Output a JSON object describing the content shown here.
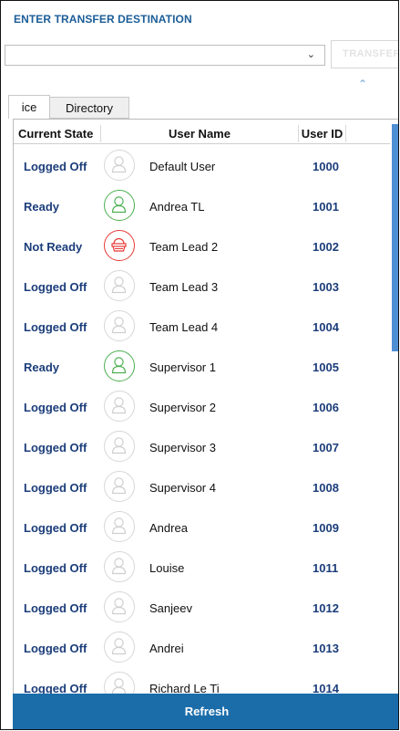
{
  "header": {
    "title": "ENTER TRANSFER DESTINATION",
    "transfer_label": "TRANSFER",
    "combo_value": ""
  },
  "tabs": [
    {
      "label": "ice",
      "active": true
    },
    {
      "label": "Directory",
      "active": false
    }
  ],
  "table": {
    "columns": [
      "Current State",
      "User Name",
      "User ID"
    ],
    "rows": [
      {
        "state": "Logged Off",
        "name": "Default User",
        "id": "1000",
        "status": "off"
      },
      {
        "state": "Ready",
        "name": "Andrea TL",
        "id": "1001",
        "status": "ready"
      },
      {
        "state": "Not Ready",
        "name": "Team Lead 2",
        "id": "1002",
        "status": "notready"
      },
      {
        "state": "Logged Off",
        "name": "Team Lead 3",
        "id": "1003",
        "status": "off"
      },
      {
        "state": "Logged Off",
        "name": "Team Lead 4",
        "id": "1004",
        "status": "off"
      },
      {
        "state": "Ready",
        "name": "Supervisor 1",
        "id": "1005",
        "status": "ready"
      },
      {
        "state": "Logged Off",
        "name": "Supervisor 2",
        "id": "1006",
        "status": "off"
      },
      {
        "state": "Logged Off",
        "name": "Supervisor 3",
        "id": "1007",
        "status": "off"
      },
      {
        "state": "Logged Off",
        "name": "Supervisor 4",
        "id": "1008",
        "status": "off"
      },
      {
        "state": "Logged Off",
        "name": "Andrea",
        "id": "1009",
        "status": "off"
      },
      {
        "state": "Logged Off",
        "name": "Louise",
        "id": "1011",
        "status": "off"
      },
      {
        "state": "Logged Off",
        "name": "Sanjeev",
        "id": "1012",
        "status": "off"
      },
      {
        "state": "Logged Off",
        "name": "Andrei",
        "id": "1013",
        "status": "off"
      },
      {
        "state": "Logged Off",
        "name": "Richard Le Ti",
        "id": "1014",
        "status": "off"
      }
    ]
  },
  "footer": {
    "refresh_label": "Refresh"
  },
  "colors": {
    "accent": "#1b6daa",
    "title": "#1b5d98",
    "state_text": "#1b3d7a",
    "ready": "#4caf50",
    "not_ready": "#e53935",
    "logged_off": "#d7d7d7",
    "scroll_thumb": "#4f8fd3"
  },
  "icons": {
    "combo_chevron": "chevron-down-icon",
    "collapse": "chevron-up-icon",
    "avatar": "user-icon",
    "not_ready_avatar": "basket-icon"
  }
}
